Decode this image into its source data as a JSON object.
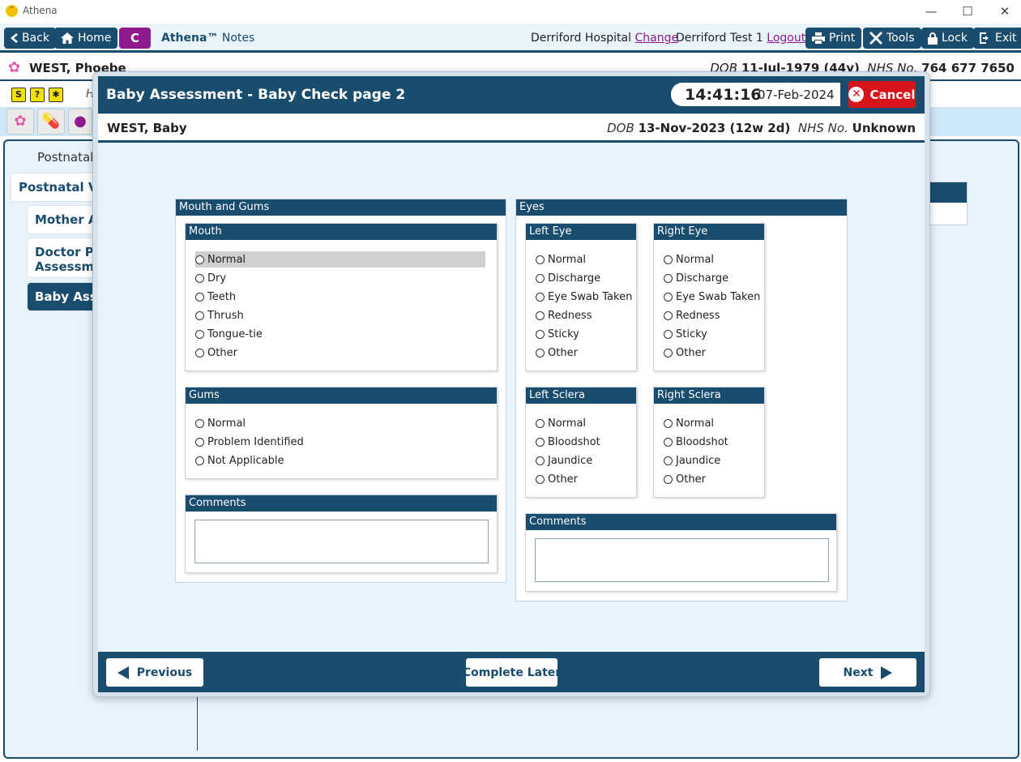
{
  "window": {
    "title": "Athena",
    "logo": "athena-logo",
    "controls": [
      "—",
      "☐",
      "✕"
    ]
  },
  "nav": {
    "back": "Back",
    "home": "Home",
    "c_label": "C",
    "brand_name": "Athena™",
    "brand_suffix": "Notes",
    "hospital": "Derriford Hospital",
    "change": "Change",
    "user": "Derriford Test 1",
    "logout": "Logout",
    "print": "Print",
    "tools": "Tools",
    "lock": "Lock",
    "exit": "Exit"
  },
  "patient": {
    "name": "WEST, Phoebe",
    "dob_label": "DOB",
    "dob": "11-Jul-1979 (44y)",
    "nhs_label": "NHS No.",
    "nhs": "764 677 7650"
  },
  "background": {
    "row_h": "H",
    "header": "Postnatal c",
    "items": [
      "Postnatal Visit",
      "Mother Ass",
      "Doctor PN",
      "Assessmen",
      "Baby Asses"
    ]
  },
  "modal": {
    "title": "Baby Assessment - Baby Check page 2",
    "time": "14:41:16",
    "date": "07-Feb-2024",
    "cancel": "Cancel",
    "baby_name": "WEST, Baby",
    "dob_label": "DOB",
    "dob": "13-Nov-2023 (12w 2d)",
    "nhs_label": "NHS No.",
    "nhs": "Unknown"
  },
  "mouth_gums": {
    "title": "Mouth and Gums",
    "mouth": {
      "title": "Mouth",
      "options": [
        "Normal",
        "Dry",
        "Teeth",
        "Thrush",
        "Tongue-tie",
        "Other"
      ]
    },
    "gums": {
      "title": "Gums",
      "options": [
        "Normal",
        "Problem Identified",
        "Not Applicable"
      ]
    },
    "comments": {
      "title": "Comments"
    }
  },
  "eyes": {
    "title": "Eyes",
    "left_eye": {
      "title": "Left Eye",
      "options": [
        "Normal",
        "Discharge",
        "Eye Swab Taken",
        "Redness",
        "Sticky",
        "Other"
      ]
    },
    "right_eye": {
      "title": "Right Eye",
      "options": [
        "Normal",
        "Discharge",
        "Eye Swab Taken",
        "Redness",
        "Sticky",
        "Other"
      ]
    },
    "left_sclera": {
      "title": "Left Sclera",
      "options": [
        "Normal",
        "Bloodshot",
        "Jaundice",
        "Other"
      ]
    },
    "right_sclera": {
      "title": "Right Sclera",
      "options": [
        "Normal",
        "Bloodshot",
        "Jaundice",
        "Other"
      ]
    },
    "comments": {
      "title": "Comments"
    }
  },
  "footer": {
    "previous": "Previous",
    "complete_later": "Complete Later",
    "next": "Next"
  }
}
